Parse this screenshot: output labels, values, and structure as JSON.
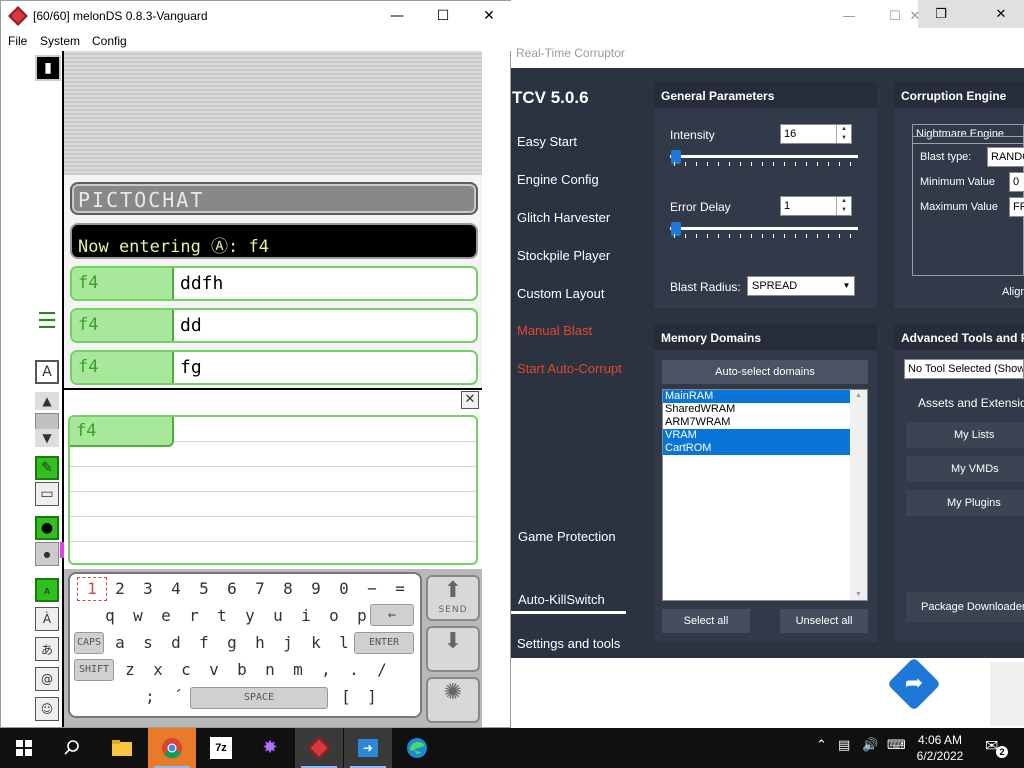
{
  "rtc": {
    "window_title": "Real-Time Corruptor",
    "version": "TCV 5.0.6",
    "nav": [
      {
        "label": "Easy Start"
      },
      {
        "label": "Engine Config"
      },
      {
        "label": "Glitch Harvester"
      },
      {
        "label": "Stockpile Player"
      },
      {
        "label": "Custom Layout"
      },
      {
        "label": "Manual Blast"
      },
      {
        "label": "Start Auto-Corrupt"
      },
      {
        "label": "Game Protection"
      },
      {
        "label": "Auto-KillSwitch"
      },
      {
        "label": "Settings and tools"
      }
    ],
    "general": {
      "title": "General Parameters",
      "intensity_label": "Intensity",
      "intensity_value": "16",
      "error_delay_label": "Error Delay",
      "error_delay_value": "1",
      "blast_radius_label": "Blast Radius:",
      "blast_radius_value": "SPREAD"
    },
    "engine": {
      "title": "Corruption Engine",
      "selected": "Nightmare Engine",
      "blast_type_label": "Blast type:",
      "blast_type_value": "RANDOM",
      "min_label": "Minimum Value",
      "min_value": "0",
      "max_label": "Maximum Value",
      "max_value": "FF",
      "align_label": "Align"
    },
    "memory": {
      "title": "Memory Domains",
      "auto_select": "Auto-select domains",
      "domains": [
        {
          "name": "MainRAM",
          "selected": true
        },
        {
          "name": "SharedWRAM",
          "selected": false
        },
        {
          "name": "ARM7WRAM",
          "selected": false
        },
        {
          "name": "VRAM",
          "selected": true
        },
        {
          "name": "CartROM",
          "selected": true
        }
      ],
      "select_all": "Select all",
      "unselect_all": "Unselect all"
    },
    "advanced": {
      "title": "Advanced Tools and Plugins",
      "tool_selected": "No Tool Selected (Show Tools)",
      "assets_label": "Assets and Extensions",
      "my_lists": "My Lists",
      "my_vmds": "My VMDs",
      "my_plugins": "My Plugins",
      "package_downloader": "Package Downloader"
    }
  },
  "melon": {
    "title": "[60/60] melonDS 0.8.3-Vanguard",
    "menu": [
      "File",
      "System",
      "Config"
    ],
    "pictochat_label": "PICTOCHAT",
    "entering_text": "Now entering Ⓐ: f4",
    "messages": [
      {
        "name": "f4",
        "text": "ddfh"
      },
      {
        "name": "f4",
        "text": "dd"
      },
      {
        "name": "f4",
        "text": "fg"
      }
    ],
    "compose_name": "f4",
    "keyboard": {
      "row1": [
        "1",
        "2",
        "3",
        "4",
        "5",
        "6",
        "7",
        "8",
        "9",
        "0",
        "−",
        "="
      ],
      "row2": [
        "q",
        "w",
        "e",
        "r",
        "t",
        "y",
        "u",
        "i",
        "o",
        "p"
      ],
      "row3": [
        "a",
        "s",
        "d",
        "f",
        "g",
        "h",
        "j",
        "k",
        "l"
      ],
      "row4": [
        "z",
        "x",
        "c",
        "v",
        "b",
        "n",
        "m",
        ",",
        ".",
        " /"
      ],
      "row5": [
        ";",
        "´",
        "[",
        "]"
      ],
      "caps": "CAPS",
      "shift": "SHIFT",
      "space": "SPACE",
      "enter": "ENTER",
      "send": "SEND"
    }
  },
  "taskbar": {
    "time": "4:06 AM",
    "date": "6/2/2022",
    "notifications": "2"
  }
}
